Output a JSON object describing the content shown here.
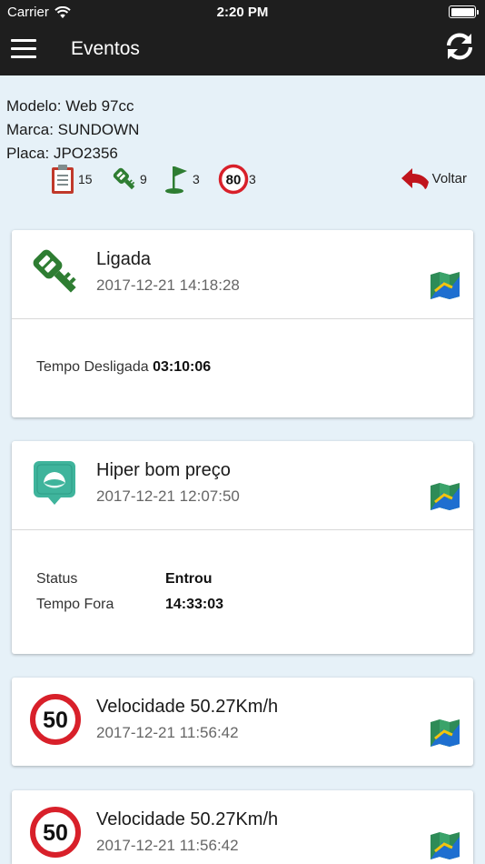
{
  "status_bar": {
    "carrier": "Carrier",
    "time": "2:20 PM"
  },
  "nav": {
    "title": "Eventos"
  },
  "vehicle": {
    "modelo": "Modelo: Web 97cc",
    "marca": "Marca: SUNDOWN",
    "placa": "Placa: JPO2356"
  },
  "summary": {
    "events_count": "15",
    "ignition_count": "9",
    "geofence_count": "3",
    "speed_limit": "80",
    "speed_count": "3",
    "back_label": "Voltar"
  },
  "colors": {
    "bar": "#1e1e1e",
    "background": "#e6f1f8",
    "key_green": "#2e7d32",
    "speed_red": "#d8202a",
    "back_red": "#c0141c"
  },
  "events": [
    {
      "icon": "ignition-key-icon",
      "title": "Ligada",
      "time": "2017-12-21 14:18:28",
      "detail_label": "Tempo Desligada",
      "detail_value": "03:10:06"
    },
    {
      "icon": "geofence-icon",
      "title": "Hiper bom preço",
      "time": "2017-12-21 12:07:50",
      "rows": [
        {
          "label": "Status",
          "value": "Entrou"
        },
        {
          "label": "Tempo Fora",
          "value": "14:33:03"
        }
      ]
    },
    {
      "icon": "speed-limit-icon",
      "speed": "50",
      "title": "Velocidade 50.27Km/h",
      "time": "2017-12-21 11:56:42"
    },
    {
      "icon": "speed-limit-icon",
      "speed": "50",
      "title": "Velocidade 50.27Km/h",
      "time": "2017-12-21 11:56:42"
    }
  ]
}
